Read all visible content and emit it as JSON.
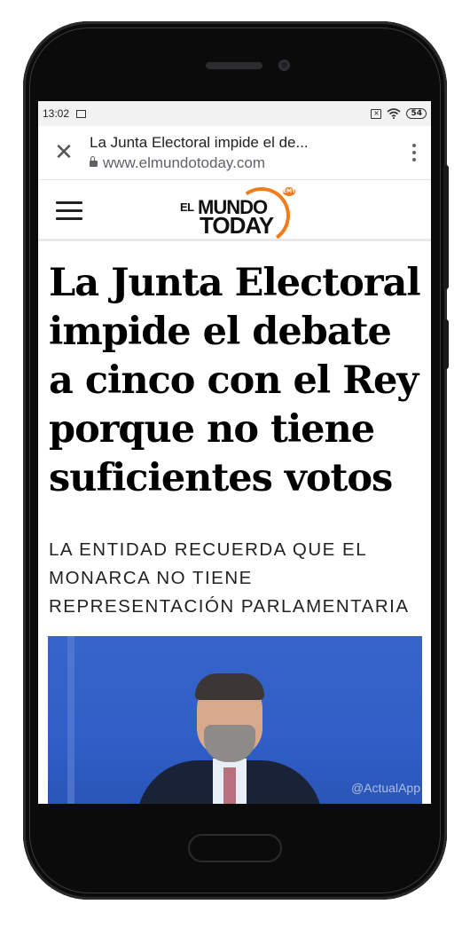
{
  "statusbar": {
    "time": "13:02",
    "battery": "54"
  },
  "browser": {
    "close_label": "✕",
    "page_title": "La Junta Electoral impide el de...",
    "domain": "www.elmundotoday.com"
  },
  "site": {
    "logo_el": "EL",
    "logo_mundo": "MUNDO",
    "logo_today": "TODAY",
    "logo_badge": "EMT",
    "accent_color": "#f07c1a"
  },
  "article": {
    "headline": "La Junta Electoral impide el debate a cinco con el Rey porque no tiene suficientes votos",
    "subhead": "LA ENTIDAD RECUERDA QUE EL MONARCA NO TIENE REPRESENTACIÓN PARLAMENTARIA",
    "photo_watermark": "@ActualApp"
  }
}
